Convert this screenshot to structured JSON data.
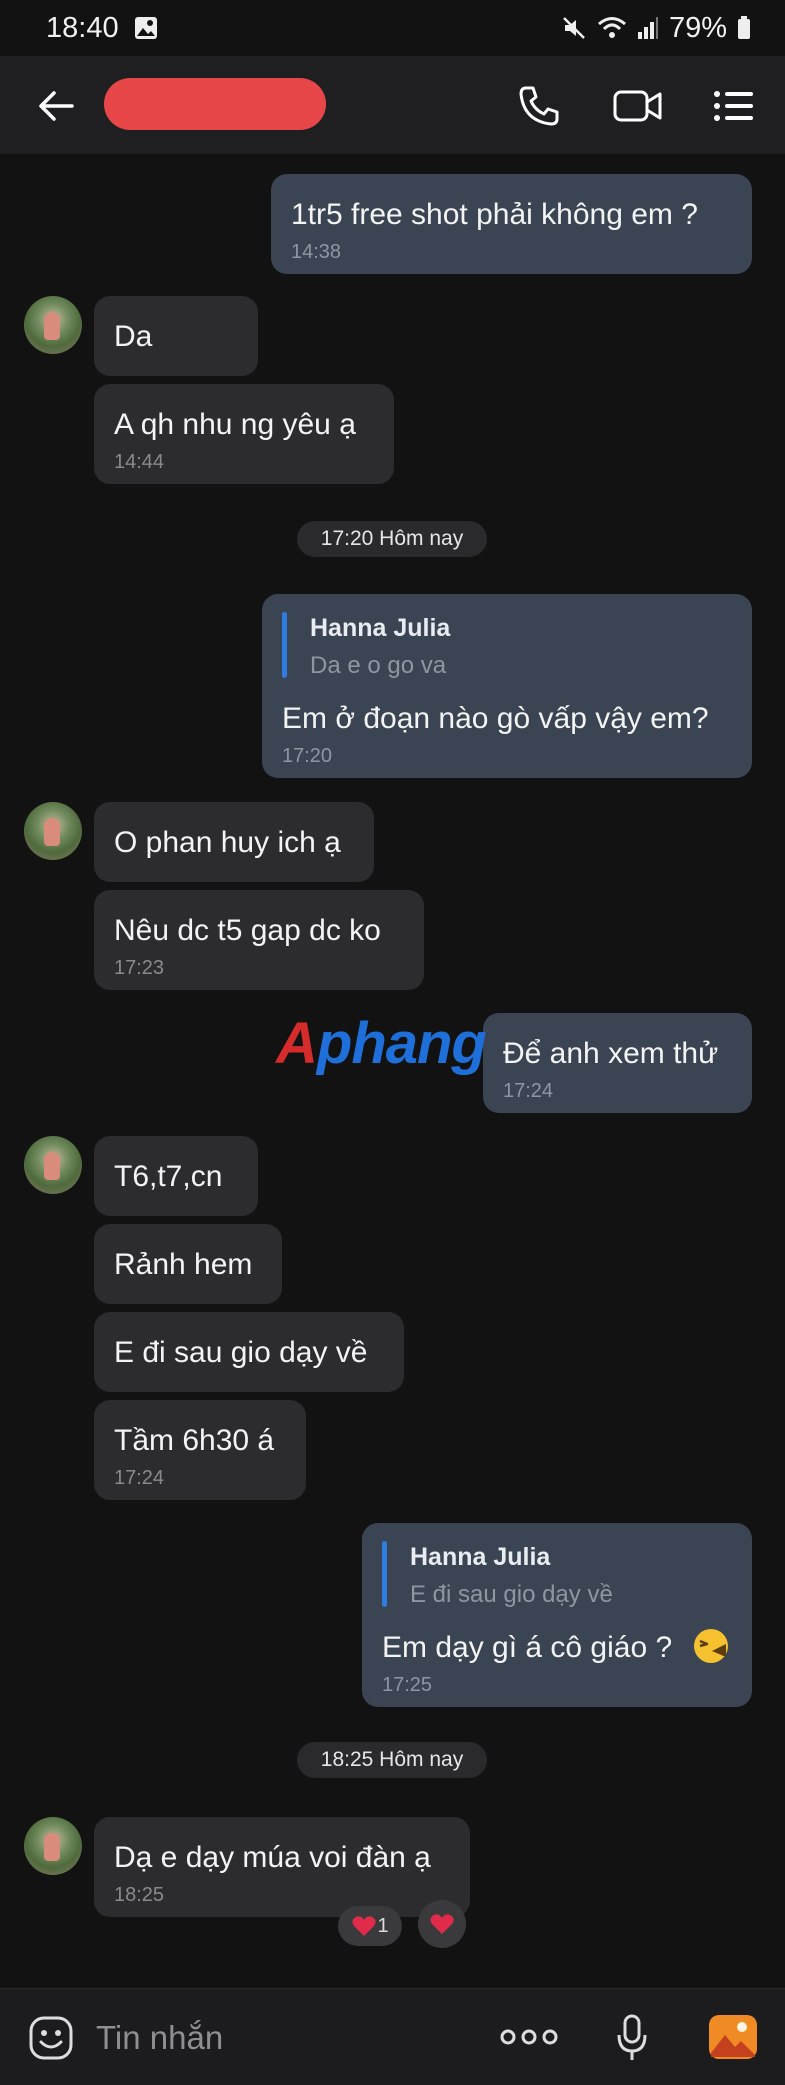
{
  "status_bar": {
    "time": "18:40",
    "battery": "79%"
  },
  "header": {
    "contact_name": ""
  },
  "messages": [
    {
      "dir": "out",
      "text": "1tr5 free shot phải không em ?",
      "time": "14:38"
    },
    {
      "dir": "in",
      "text": "Da"
    },
    {
      "dir": "in",
      "text": "A qh nhu ng yêu ạ",
      "time": "14:44"
    },
    {
      "dir": "out",
      "reply_name": "Hanna Julia",
      "reply_text": "Da e o go va",
      "text": "Em ở đoạn nào gò vấp vậy em?",
      "time": "17:20"
    },
    {
      "dir": "in",
      "text": "O phan huy ich ạ"
    },
    {
      "dir": "in",
      "text": "Nêu dc t5 gap dc ko",
      "time": "17:23"
    },
    {
      "dir": "out",
      "text": "Để anh xem thử",
      "time": "17:24"
    },
    {
      "dir": "in",
      "text": "T6,t7,cn"
    },
    {
      "dir": "in",
      "text": "Rảnh hem"
    },
    {
      "dir": "in",
      "text": "E đi sau gio dạy về"
    },
    {
      "dir": "in",
      "text": "Tầm 6h30 á",
      "time": "17:24"
    },
    {
      "dir": "out",
      "reply_name": "Hanna Julia",
      "reply_text": "E đi sau gio dạy về",
      "text": "Em dạy gì á cô giáo ?",
      "time": "17:25"
    },
    {
      "dir": "in",
      "text": "Dạ e dạy múa voi đàn ạ",
      "time": "18:25"
    }
  ],
  "date_separators": [
    "17:20 Hôm nay",
    "18:25 Hôm nay"
  ],
  "reactions": {
    "heart_count": "1"
  },
  "watermark": {
    "part1": "A",
    "part2": "phang"
  },
  "composer": {
    "placeholder": "Tin nhắn"
  },
  "colors": {
    "outgoing_bubble": "#3a4452",
    "incoming_bubble": "#2c2c2e",
    "reply_accent": "#2f7de1",
    "watermark_red": "#d62b2b",
    "watermark_blue": "#1e6fd9"
  },
  "icons": [
    "back-arrow-icon",
    "phone-icon",
    "video-call-icon",
    "menu-list-icon",
    "emoji-icon",
    "more-icon",
    "microphone-icon",
    "gallery-icon",
    "heart-icon",
    "laughing-emoji-icon"
  ]
}
